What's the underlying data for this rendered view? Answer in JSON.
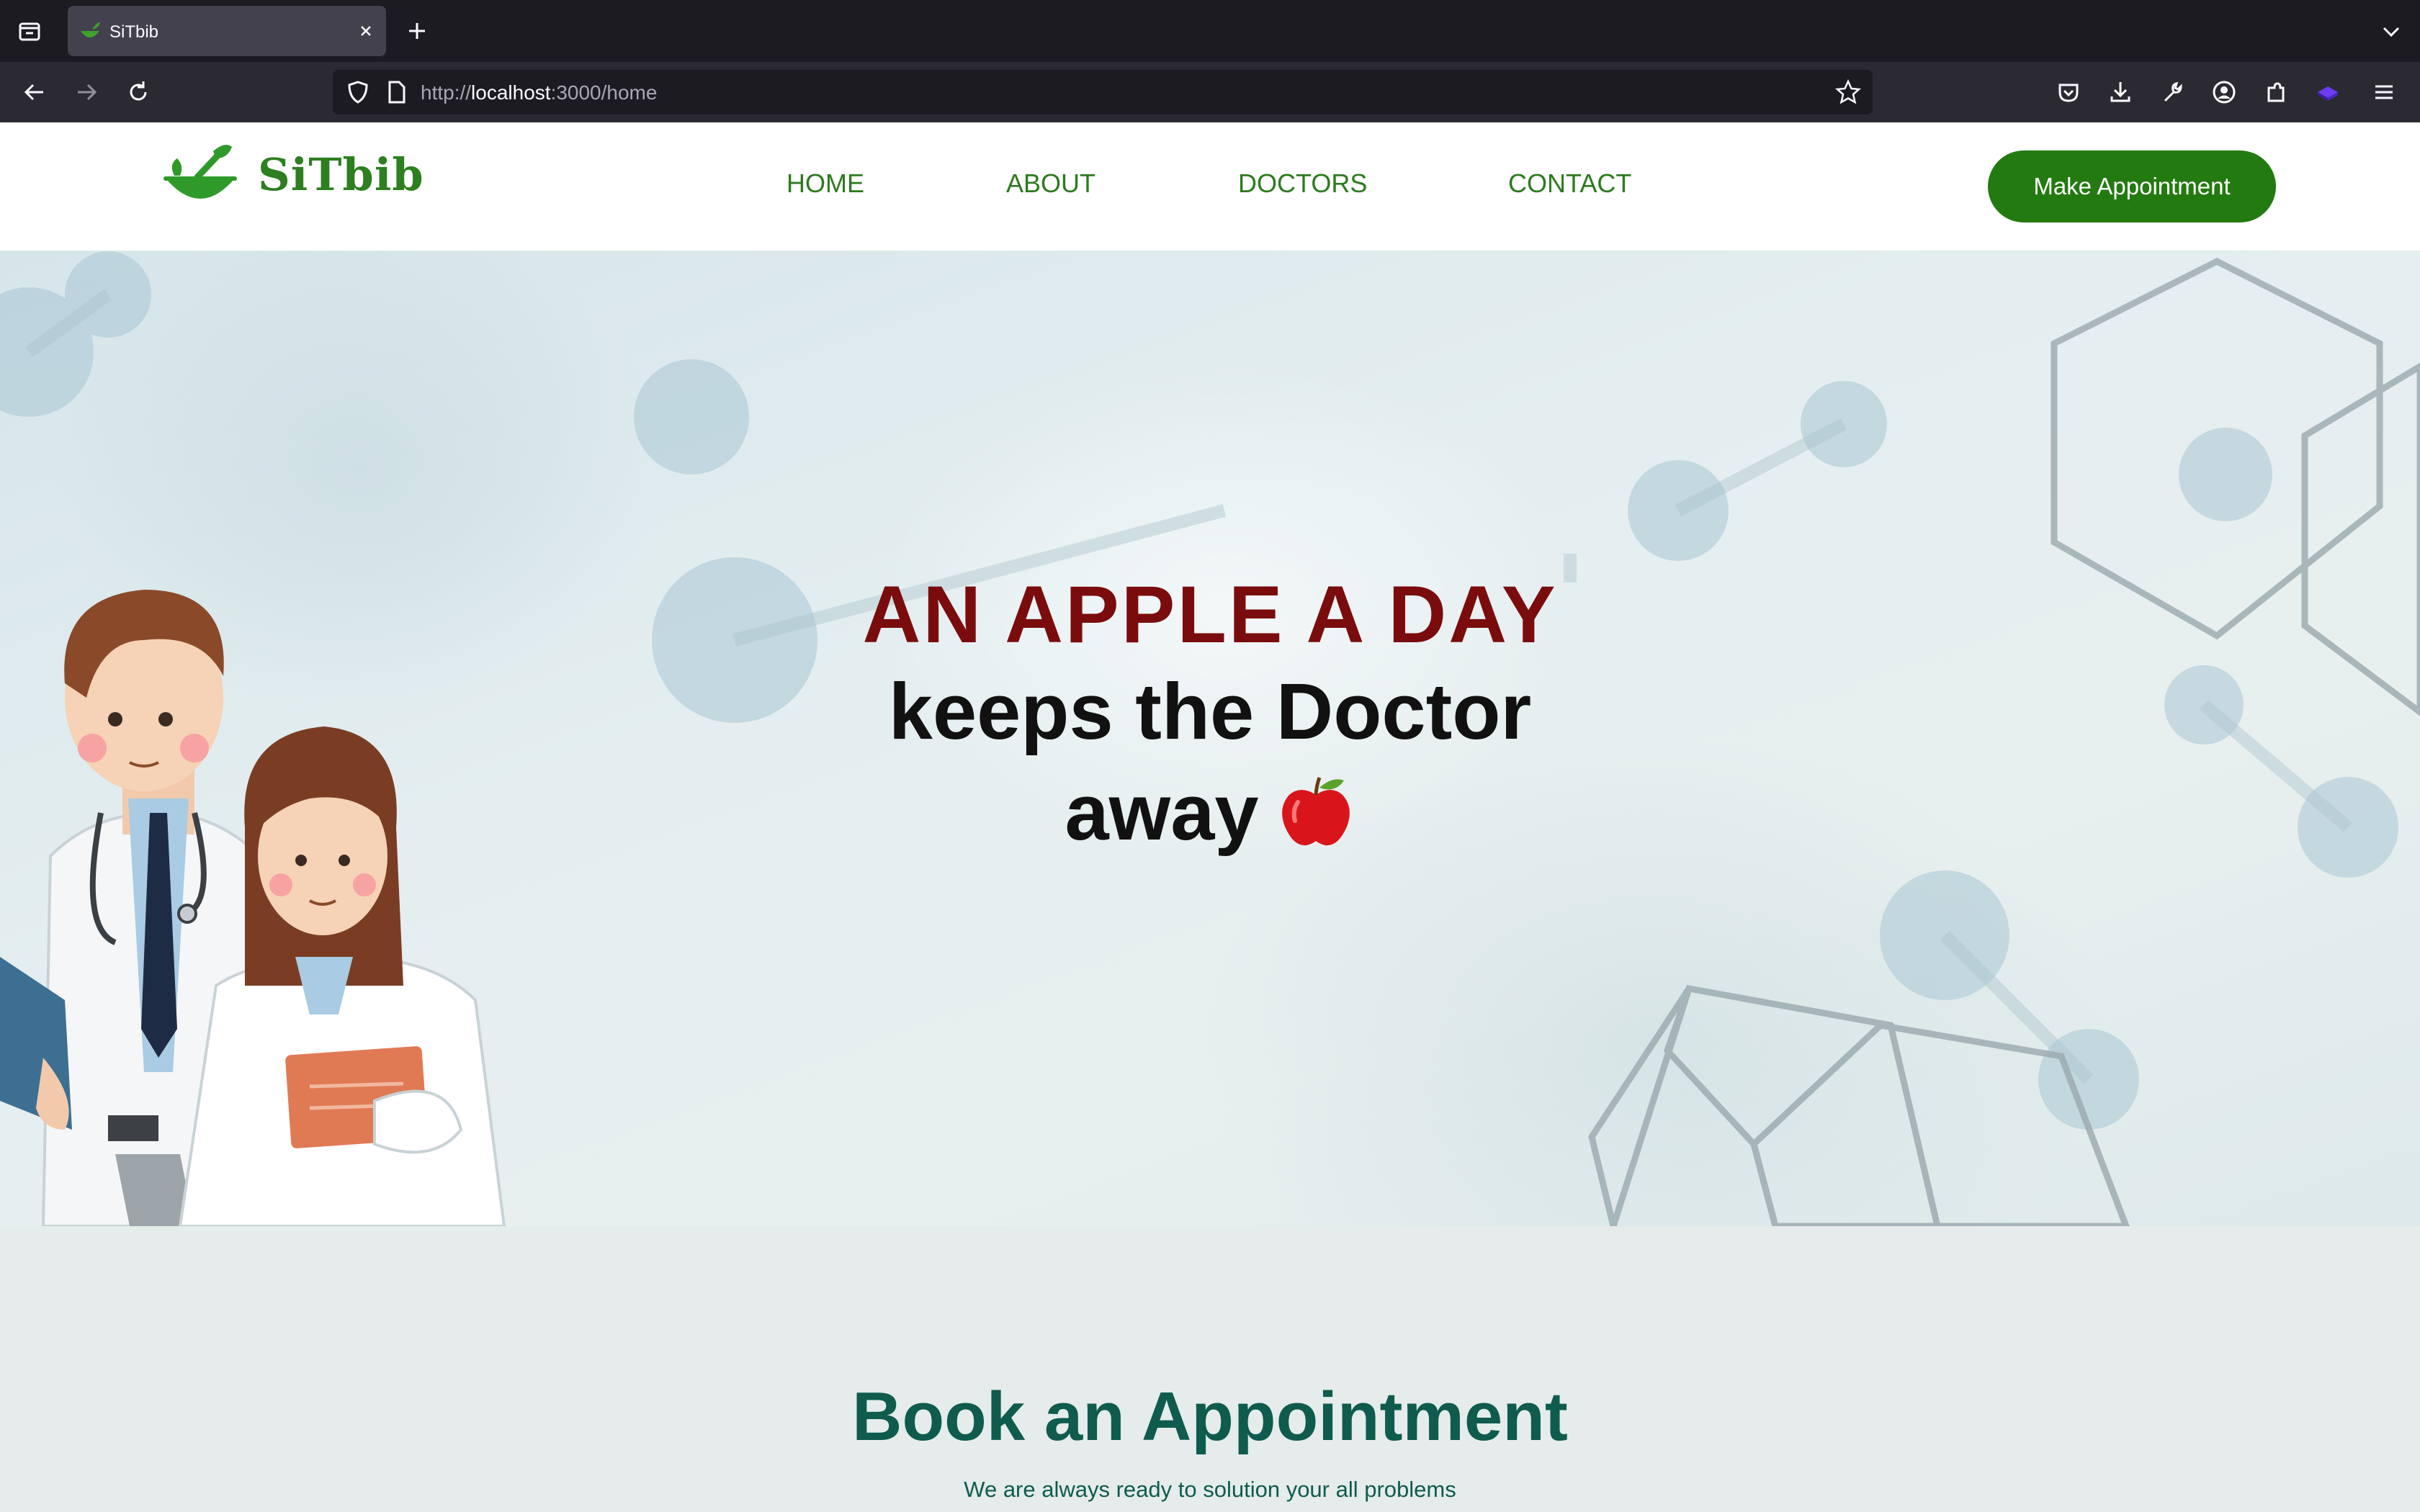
{
  "browser": {
    "tab_title": "SiTbib",
    "url_prefix": "http://",
    "url_host": "localhost",
    "url_path": ":3000/home"
  },
  "header": {
    "logo_text": "SiTbib",
    "nav": [
      {
        "label": "HOME"
      },
      {
        "label": "ABOUT"
      },
      {
        "label": "DOCTORS"
      },
      {
        "label": "CONTACT"
      }
    ],
    "cta_label": "Make Appointment"
  },
  "hero": {
    "line1": "AN APPLE A DAY",
    "line2": "keeps the Doctor away",
    "emoji_icon": "red-apple-icon"
  },
  "book": {
    "title": "Book an Appointment",
    "subtitle": "We are always ready to solution your all problems"
  },
  "colors": {
    "brand_green": "#237a10",
    "nav_green": "#2d7a1f",
    "hero_red": "#7a0c0e",
    "book_teal": "#0f5b4d"
  }
}
